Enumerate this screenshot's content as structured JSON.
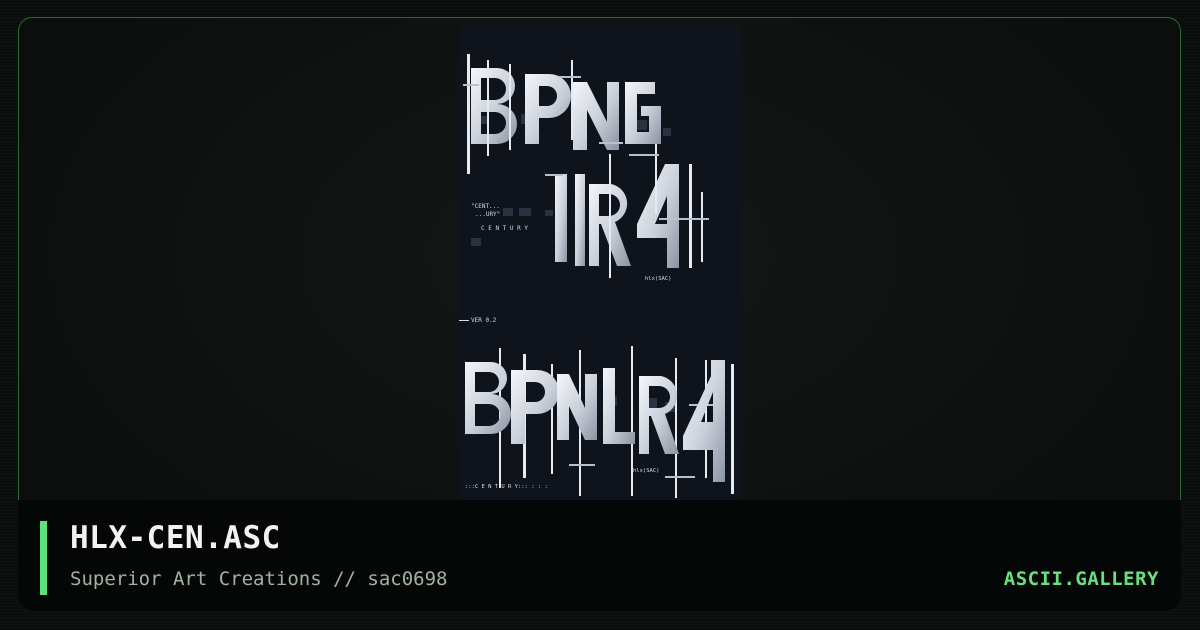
{
  "artwork": {
    "label_cent": "\"CENT...",
    "label_ury": "...URY\"",
    "label_century": "C E N T U R Y",
    "label_hlx_top": "hlx(SAC)",
    "label_version": "VER 0.2",
    "label_hlx_bottom": "hlx(SAC)",
    "label_century_bottom": ":::C E N T U R Y::: : :   :"
  },
  "caption": {
    "title": "HLX-CEN.ASC",
    "subtitle": "Superior Art Creations // sac0698",
    "brand": "ASCII.GALLERY"
  },
  "colors": {
    "accent": "#5ee07a",
    "brand": "#69e07f",
    "frame_border": "#2e6a36",
    "art_background": "#0f141c"
  }
}
